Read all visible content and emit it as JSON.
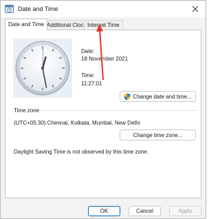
{
  "window": {
    "title": "Date and Time",
    "close_icon": "close-icon",
    "app_icon": "clock-app-icon"
  },
  "tabs": [
    {
      "label": "Date and Time",
      "active": true
    },
    {
      "label": "Additional Clocks",
      "active": false
    },
    {
      "label": "Internet Time",
      "active": false
    }
  ],
  "datetime": {
    "date_label": "Date:",
    "date_value": "18 November 2021",
    "time_label": "Time:",
    "time_value": "11:27:01",
    "change_button": "Change date and time...",
    "change_button_icon": "shield-icon"
  },
  "timezone": {
    "section_label": "Time zone",
    "value": "(UTC+05:30) Chennai, Kolkata, Mumbai, New Delhi",
    "change_button": "Change time zone...",
    "dst_note": "Daylight Saving Time is not observed by this time zone."
  },
  "footer": {
    "ok": "OK",
    "cancel": "Cancel",
    "apply": "Apply"
  },
  "colors": {
    "accent": "#0067c0",
    "annotation_arrow": "#e8332a",
    "clock_face": "#e9eff5"
  }
}
